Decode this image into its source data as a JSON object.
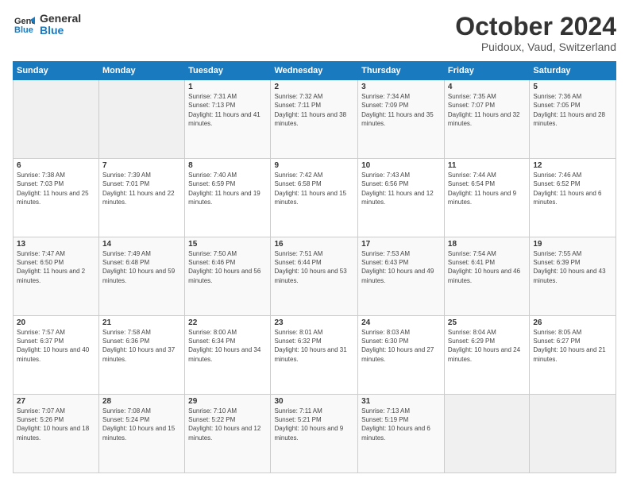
{
  "logo": {
    "line1": "General",
    "line2": "Blue"
  },
  "header": {
    "month": "October 2024",
    "location": "Puidoux, Vaud, Switzerland"
  },
  "weekdays": [
    "Sunday",
    "Monday",
    "Tuesday",
    "Wednesday",
    "Thursday",
    "Friday",
    "Saturday"
  ],
  "weeks": [
    [
      {
        "day": "",
        "info": ""
      },
      {
        "day": "",
        "info": ""
      },
      {
        "day": "1",
        "info": "Sunrise: 7:31 AM\nSunset: 7:13 PM\nDaylight: 11 hours and 41 minutes."
      },
      {
        "day": "2",
        "info": "Sunrise: 7:32 AM\nSunset: 7:11 PM\nDaylight: 11 hours and 38 minutes."
      },
      {
        "day": "3",
        "info": "Sunrise: 7:34 AM\nSunset: 7:09 PM\nDaylight: 11 hours and 35 minutes."
      },
      {
        "day": "4",
        "info": "Sunrise: 7:35 AM\nSunset: 7:07 PM\nDaylight: 11 hours and 32 minutes."
      },
      {
        "day": "5",
        "info": "Sunrise: 7:36 AM\nSunset: 7:05 PM\nDaylight: 11 hours and 28 minutes."
      }
    ],
    [
      {
        "day": "6",
        "info": "Sunrise: 7:38 AM\nSunset: 7:03 PM\nDaylight: 11 hours and 25 minutes."
      },
      {
        "day": "7",
        "info": "Sunrise: 7:39 AM\nSunset: 7:01 PM\nDaylight: 11 hours and 22 minutes."
      },
      {
        "day": "8",
        "info": "Sunrise: 7:40 AM\nSunset: 6:59 PM\nDaylight: 11 hours and 19 minutes."
      },
      {
        "day": "9",
        "info": "Sunrise: 7:42 AM\nSunset: 6:58 PM\nDaylight: 11 hours and 15 minutes."
      },
      {
        "day": "10",
        "info": "Sunrise: 7:43 AM\nSunset: 6:56 PM\nDaylight: 11 hours and 12 minutes."
      },
      {
        "day": "11",
        "info": "Sunrise: 7:44 AM\nSunset: 6:54 PM\nDaylight: 11 hours and 9 minutes."
      },
      {
        "day": "12",
        "info": "Sunrise: 7:46 AM\nSunset: 6:52 PM\nDaylight: 11 hours and 6 minutes."
      }
    ],
    [
      {
        "day": "13",
        "info": "Sunrise: 7:47 AM\nSunset: 6:50 PM\nDaylight: 11 hours and 2 minutes."
      },
      {
        "day": "14",
        "info": "Sunrise: 7:49 AM\nSunset: 6:48 PM\nDaylight: 10 hours and 59 minutes."
      },
      {
        "day": "15",
        "info": "Sunrise: 7:50 AM\nSunset: 6:46 PM\nDaylight: 10 hours and 56 minutes."
      },
      {
        "day": "16",
        "info": "Sunrise: 7:51 AM\nSunset: 6:44 PM\nDaylight: 10 hours and 53 minutes."
      },
      {
        "day": "17",
        "info": "Sunrise: 7:53 AM\nSunset: 6:43 PM\nDaylight: 10 hours and 49 minutes."
      },
      {
        "day": "18",
        "info": "Sunrise: 7:54 AM\nSunset: 6:41 PM\nDaylight: 10 hours and 46 minutes."
      },
      {
        "day": "19",
        "info": "Sunrise: 7:55 AM\nSunset: 6:39 PM\nDaylight: 10 hours and 43 minutes."
      }
    ],
    [
      {
        "day": "20",
        "info": "Sunrise: 7:57 AM\nSunset: 6:37 PM\nDaylight: 10 hours and 40 minutes."
      },
      {
        "day": "21",
        "info": "Sunrise: 7:58 AM\nSunset: 6:36 PM\nDaylight: 10 hours and 37 minutes."
      },
      {
        "day": "22",
        "info": "Sunrise: 8:00 AM\nSunset: 6:34 PM\nDaylight: 10 hours and 34 minutes."
      },
      {
        "day": "23",
        "info": "Sunrise: 8:01 AM\nSunset: 6:32 PM\nDaylight: 10 hours and 31 minutes."
      },
      {
        "day": "24",
        "info": "Sunrise: 8:03 AM\nSunset: 6:30 PM\nDaylight: 10 hours and 27 minutes."
      },
      {
        "day": "25",
        "info": "Sunrise: 8:04 AM\nSunset: 6:29 PM\nDaylight: 10 hours and 24 minutes."
      },
      {
        "day": "26",
        "info": "Sunrise: 8:05 AM\nSunset: 6:27 PM\nDaylight: 10 hours and 21 minutes."
      }
    ],
    [
      {
        "day": "27",
        "info": "Sunrise: 7:07 AM\nSunset: 5:26 PM\nDaylight: 10 hours and 18 minutes."
      },
      {
        "day": "28",
        "info": "Sunrise: 7:08 AM\nSunset: 5:24 PM\nDaylight: 10 hours and 15 minutes."
      },
      {
        "day": "29",
        "info": "Sunrise: 7:10 AM\nSunset: 5:22 PM\nDaylight: 10 hours and 12 minutes."
      },
      {
        "day": "30",
        "info": "Sunrise: 7:11 AM\nSunset: 5:21 PM\nDaylight: 10 hours and 9 minutes."
      },
      {
        "day": "31",
        "info": "Sunrise: 7:13 AM\nSunset: 5:19 PM\nDaylight: 10 hours and 6 minutes."
      },
      {
        "day": "",
        "info": ""
      },
      {
        "day": "",
        "info": ""
      }
    ]
  ]
}
